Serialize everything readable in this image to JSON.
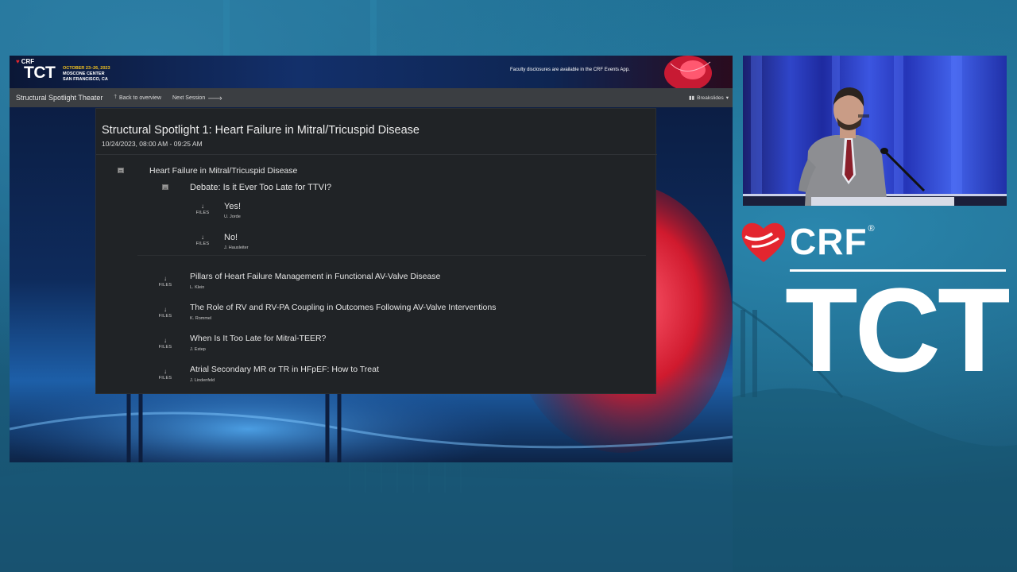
{
  "banner": {
    "crf": "CRF",
    "tct": "TCT",
    "dates": "OCTOBER 23–26, 2023",
    "venue": "MOSCONE CENTER",
    "city": "SAN FRANCISCO, CA",
    "note": "Faculty disclosures are available in the CRF Events App."
  },
  "navbar": {
    "brand": "Structural Spotlight Theater",
    "back": "Back to overview",
    "next": "Next Session",
    "breakslides": "Breakslides"
  },
  "session": {
    "title": "Structural Spotlight 1: Heart Failure in Mitral/Tricuspid Disease",
    "datetime": "10/24/2023, 08:00 AM - 09:25 AM"
  },
  "agenda": {
    "group_title": "Heart Failure in Mitral/Tricuspid Disease",
    "debate_title": "Debate: Is it Ever Too Late for TTVI?",
    "files_label": "FILES",
    "debate_items": [
      {
        "title": "Yes!",
        "author": "U. Jorde"
      },
      {
        "title": "No!",
        "author": "J. Hausleiter"
      }
    ],
    "talks": [
      {
        "title": "Pillars of Heart Failure Management in Functional AV-Valve Disease",
        "author": "L. Klein"
      },
      {
        "title": "The Role of RV and RV-PA Coupling in Outcomes Following AV-Valve Interventions",
        "author": "K. Rommel"
      },
      {
        "title": "When Is It Too Late for Mitral-TEER?",
        "author": "J. Estep"
      },
      {
        "title": "Atrial Secondary MR or TR in HFpEF: How to Treat",
        "author": "J. Lindenfeld"
      }
    ]
  },
  "logo": {
    "crf": "CRF",
    "registered": "®",
    "tct": "TCT"
  },
  "colors": {
    "accent_red": "#e3262f",
    "panel": "#202326",
    "navbar": "#3b3e42",
    "background": "#1f6f93"
  }
}
